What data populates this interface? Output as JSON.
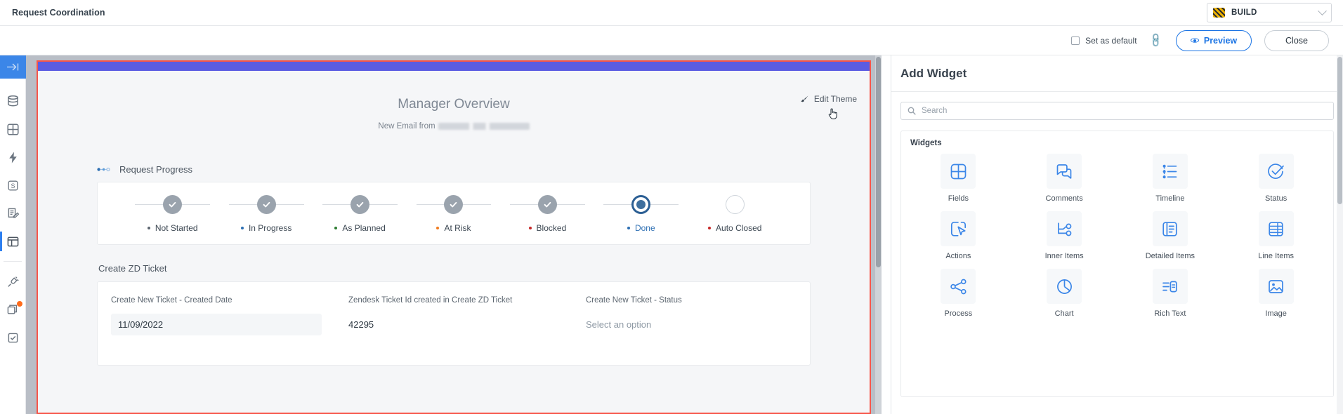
{
  "topbar": {
    "title": "Request Coordination",
    "build_label": "BUILD",
    "build_swatch_color": "#f0b400"
  },
  "subbar": {
    "set_as_default_label": "Set as default",
    "preview_label": "Preview",
    "close_label": "Close"
  },
  "rail": {
    "items": [
      {
        "name": "collapse-arrow",
        "label": ""
      },
      {
        "name": "database",
        "label": ""
      },
      {
        "name": "grid",
        "label": ""
      },
      {
        "name": "bolt",
        "label": ""
      },
      {
        "name": "s-badge",
        "label": ""
      },
      {
        "name": "form-edit",
        "label": ""
      },
      {
        "name": "layout",
        "label": ""
      },
      {
        "name": "plug",
        "label": ""
      },
      {
        "name": "copies",
        "label": ""
      },
      {
        "name": "task-check",
        "label": ""
      }
    ]
  },
  "hero": {
    "title": "Manager Overview",
    "subtitle_prefix": "New Email from",
    "edit_theme_label": "Edit Theme",
    "theme_bar_color": "#5b5ce2",
    "selection_outline_color": "#f7564a"
  },
  "request_progress": {
    "section_title": "Request Progress",
    "steps": [
      {
        "label": "Not Started",
        "state": "complete",
        "dot_color": "#5c6670"
      },
      {
        "label": "In Progress",
        "state": "complete",
        "dot_color": "#2d6fb3"
      },
      {
        "label": "As Planned",
        "state": "complete",
        "dot_color": "#2e7d32"
      },
      {
        "label": "At Risk",
        "state": "complete",
        "dot_color": "#f07c20"
      },
      {
        "label": "Blocked",
        "state": "complete",
        "dot_color": "#c62828"
      },
      {
        "label": "Done",
        "state": "current",
        "dot_color": "#2d6fb3"
      },
      {
        "label": "Auto Closed",
        "state": "empty",
        "dot_color": "#c62828"
      }
    ]
  },
  "create_zd_ticket": {
    "section_title": "Create ZD Ticket",
    "fields": [
      {
        "label": "Create New Ticket - Created Date",
        "value": "11/09/2022",
        "style": "boxed"
      },
      {
        "label": "Zendesk Ticket Id created in Create ZD Ticket",
        "value": "42295",
        "style": "plain"
      },
      {
        "label": "Create New Ticket - Status",
        "value": "Select an option",
        "style": "placeholder"
      }
    ]
  },
  "add_widget_panel": {
    "title": "Add Widget",
    "search_placeholder": "Search",
    "widgets_group_title": "Widgets",
    "widgets": [
      {
        "label": "Fields",
        "icon": "fields-icon"
      },
      {
        "label": "Comments",
        "icon": "comments-icon"
      },
      {
        "label": "Timeline",
        "icon": "timeline-icon"
      },
      {
        "label": "Status",
        "icon": "status-icon"
      },
      {
        "label": "Actions",
        "icon": "actions-icon"
      },
      {
        "label": "Inner Items",
        "icon": "inner-items-icon"
      },
      {
        "label": "Detailed Items",
        "icon": "detailed-items-icon"
      },
      {
        "label": "Line Items",
        "icon": "line-items-icon"
      },
      {
        "label": "Process",
        "icon": "process-icon"
      },
      {
        "label": "Chart",
        "icon": "chart-icon"
      },
      {
        "label": "Rich Text",
        "icon": "rich-text-icon"
      },
      {
        "label": "Image",
        "icon": "image-icon"
      }
    ],
    "accent_color": "#3b86e8"
  }
}
